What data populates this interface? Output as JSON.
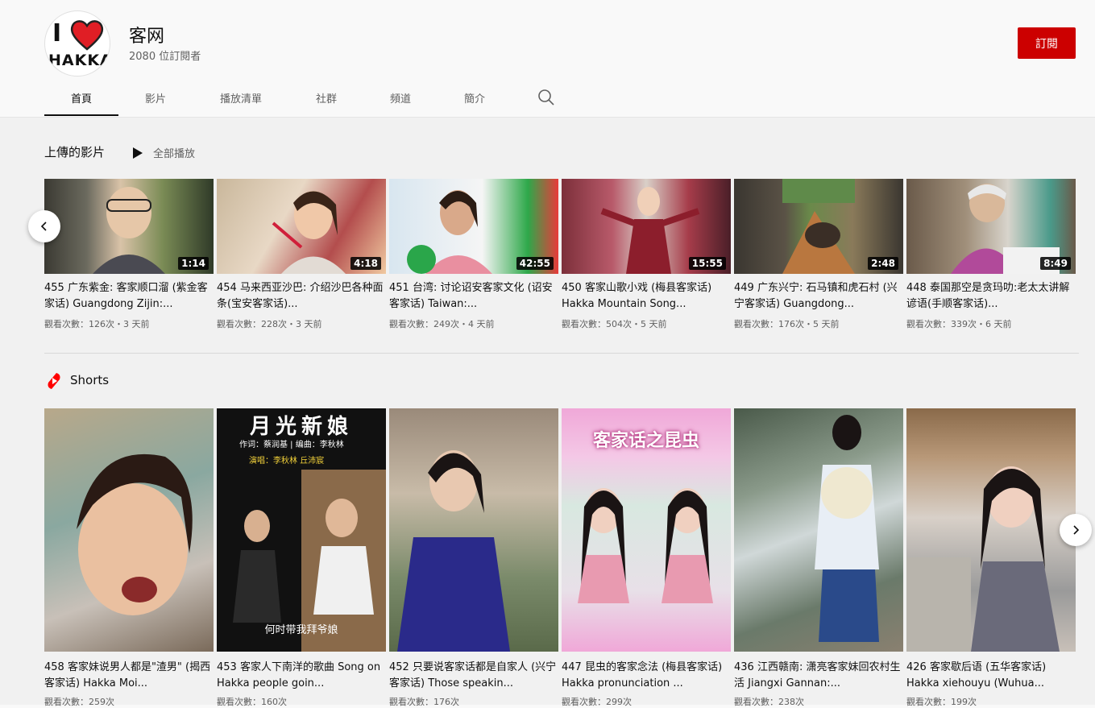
{
  "channel": {
    "name": "客网",
    "subscribers": "2080 位訂閱者",
    "logo_i": "I",
    "logo_word": "HAKKA"
  },
  "subscribe_label": "訂閱",
  "tabs": [
    "首頁",
    "影片",
    "播放清單",
    "社群",
    "頻道",
    "簡介"
  ],
  "colors": {
    "brand_red": "#cc0000",
    "shorts_red": "#ff0000"
  },
  "uploads": {
    "title": "上傳的影片",
    "play_all": "全部播放",
    "videos": [
      {
        "title": "455 广东紫金: 客家顺口溜 (紫金客家话) Guangdong Zijin:...",
        "duration": "1:14",
        "meta": "觀看次數：126次・3 天前"
      },
      {
        "title": "454 马来西亚沙巴: 介绍沙巴各种面条(宝安客家话)...",
        "duration": "4:18",
        "meta": "觀看次數：228次・3 天前"
      },
      {
        "title": "451 台湾: 讨论诏安客家文化 (诏安客家话) Taiwan:...",
        "duration": "42:55",
        "meta": "觀看次數：249次・4 天前"
      },
      {
        "title": "450 客家山歌小戏 (梅县客家话) Hakka Mountain Song...",
        "duration": "15:55",
        "meta": "觀看次數：504次・5 天前"
      },
      {
        "title": "449 广东兴宁: 石马镇和虎石村 (兴宁客家话) Guangdong...",
        "duration": "2:48",
        "meta": "觀看次數：176次・5 天前"
      },
      {
        "title": "448 泰国那空是贪玛叻:老太太讲解谚语(手顺客家话)...",
        "duration": "8:49",
        "meta": "觀看次數：339次・6 天前"
      }
    ]
  },
  "shorts": {
    "title": "Shorts",
    "items": [
      {
        "title": "458 客家妹说男人都是\"渣男\" (揭西客家话) Hakka Moi...",
        "meta": "觀看次數：259次"
      },
      {
        "title": "453 客家人下南洋的歌曲 Song on Hakka people goin...",
        "meta": "觀看次數：160次",
        "overlay_title": "月光新娘",
        "overlay_lines": [
          "作词：蔡润基  |  编曲：李秋林",
          "演唱：李秋林  丘沛宸"
        ],
        "overlay_bottom": "何时带我拜爷娘"
      },
      {
        "title": "452 只要说客家话都是自家人 (兴宁客家话) Those speakin...",
        "meta": "觀看次數：176次"
      },
      {
        "title": "447 昆虫的客家念法 (梅县客家话) Hakka pronunciation ...",
        "meta": "觀看次數：299次",
        "overlay_title": "客家话之昆虫"
      },
      {
        "title": "436 江西赣南: 潇亮客家妹回农村生活 Jiangxi Gannan:...",
        "meta": "觀看次數：238次"
      },
      {
        "title": "426 客家歇后语 (五华客家话) Hakka xiehouyu (Wuhua...",
        "meta": "觀看次數：199次"
      }
    ]
  }
}
